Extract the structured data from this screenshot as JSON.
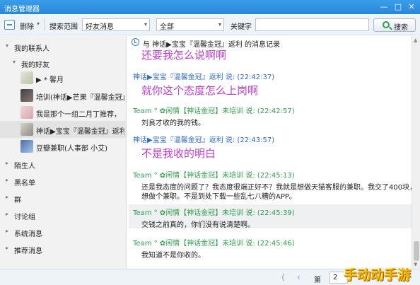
{
  "window": {
    "title": "消息管理器",
    "min_glyph": "—",
    "max_glyph": "□",
    "close_glyph": "✕"
  },
  "toolbar": {
    "delete_label": "删除",
    "search_scope_label": "搜索范围",
    "scope_value": "好友消息",
    "range_value": "全部",
    "keyword_label": "关键字",
    "keyword_value": "",
    "search_label": "搜索",
    "caret": "▾"
  },
  "sidebar": {
    "root": "我的联系人",
    "group": "我的好友",
    "contacts": [
      {
        "name": "▶ * 馨月"
      },
      {
        "name": "培训(神话▶芒果『温馨金冠』"
      },
      {
        "name": "我是那个一组二月丁推荐，"
      },
      {
        "name": "神话▶宝宝『温馨金冠』返利"
      },
      {
        "name": "豆瓣兼职(人事部 小艾)"
      }
    ],
    "categories": [
      "陌生人",
      "黑名单",
      "群",
      "讨论组",
      "系统消息",
      "推荐消息"
    ],
    "arrow_expanded": "▾",
    "arrow_collapsed": "▸"
  },
  "chat": {
    "header": "与 神话▶宝宝『温馨金冠』返利 的消息记录",
    "messages": [
      {
        "text": "还要我怎么说啊啊"
      },
      {
        "meta": "神话▶宝宝『温馨金冠』返利 说: (22:42:37)",
        "text": "就你这个态度怎么上岗啊"
      },
      {
        "meta": "Team ° ✿闲情【神话金冠】未培训 说: (22:42:57)",
        "text": "刘良才收的我的钱。"
      },
      {
        "meta": "神话▶宝宝『温馨金冠』返利 说: (22:43:57)",
        "text": "不是我收的明白"
      },
      {
        "meta": "Team ° ✿闲情【神话金冠】未培训 说: (22:45:13)",
        "text": "还是我态度的问题了？我态度很端正好不？我就是想做天猫客服的兼职。我交了400块，就是",
        "text2": "想做个兼职。不是到处下载一些乱七八糟的APP。"
      },
      {
        "meta": "Team ° ✿闲情【神话金冠】未培训 说: (22:45:39)",
        "text": "交钱之前真的，你们没有说清楚啊。"
      },
      {
        "meta": "Team ° ✿闲情【神话金冠】未培训 说: (22:45:46)",
        "text": "我知道不是你收的。"
      }
    ]
  },
  "footer": {
    "first": "⟨",
    "prev": "‹",
    "page_label": "第",
    "page_value": "2"
  },
  "watermark": {
    "text": "手动动手游"
  },
  "colors": {
    "titlebar": "#2a86d8",
    "friend_name": "#2f6cc8",
    "self_name": "#2f9d4a",
    "big_text": "#c23bd4",
    "watermark": "#f2b400"
  }
}
